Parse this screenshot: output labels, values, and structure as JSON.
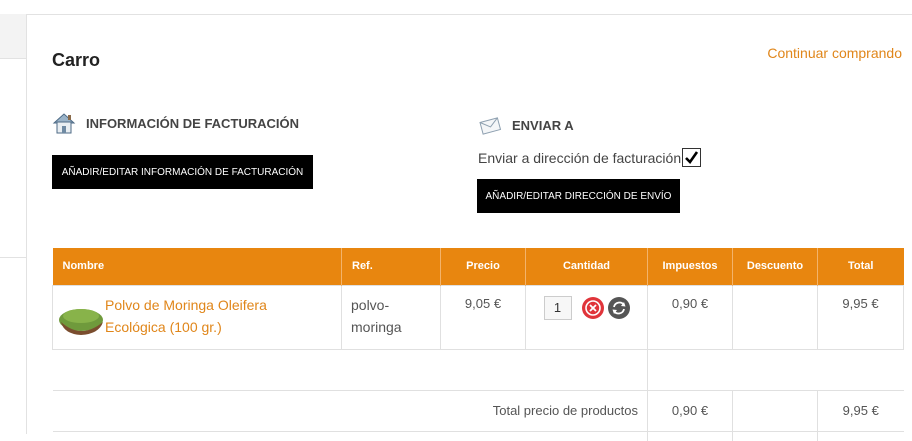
{
  "page": {
    "title": "Carro",
    "continue_link": "Continuar comprando"
  },
  "billing": {
    "heading": "INFORMACIÓN DE FACTURACIÓN",
    "button": "AÑADIR/EDITAR INFORMACIÓN DE FACTURACIÓN",
    "icon": "house-icon"
  },
  "shipping": {
    "heading": "ENVIAR A",
    "checkbox_label": "Enviar a dirección de facturación",
    "checkbox_checked": true,
    "button": "AÑADIR/EDITAR DIRECCIÓN DE ENVÍO",
    "icon": "envelope-icon"
  },
  "table": {
    "headers": [
      "Nombre",
      "Ref.",
      "Precio",
      "Cantidad",
      "Impuestos",
      "Descuento",
      "Total"
    ],
    "rows": [
      {
        "name_line1": "Polvo de Moringa Oleifera",
        "name_line2": "Ecológica (100 gr.)",
        "ref_line1": "polvo-",
        "ref_line2": "moringa",
        "price": "9,05 €",
        "quantity": "1",
        "tax": "0,90 €",
        "discount": "",
        "total": "9,95 €"
      }
    ],
    "totals": {
      "label": "Total precio de productos",
      "tax": "0,90 €",
      "discount": "",
      "total": "9,95 €"
    }
  },
  "colors": {
    "accent": "#e8860f",
    "link": "#e0861a",
    "remove": "#e0343a",
    "refresh": "#555555"
  }
}
